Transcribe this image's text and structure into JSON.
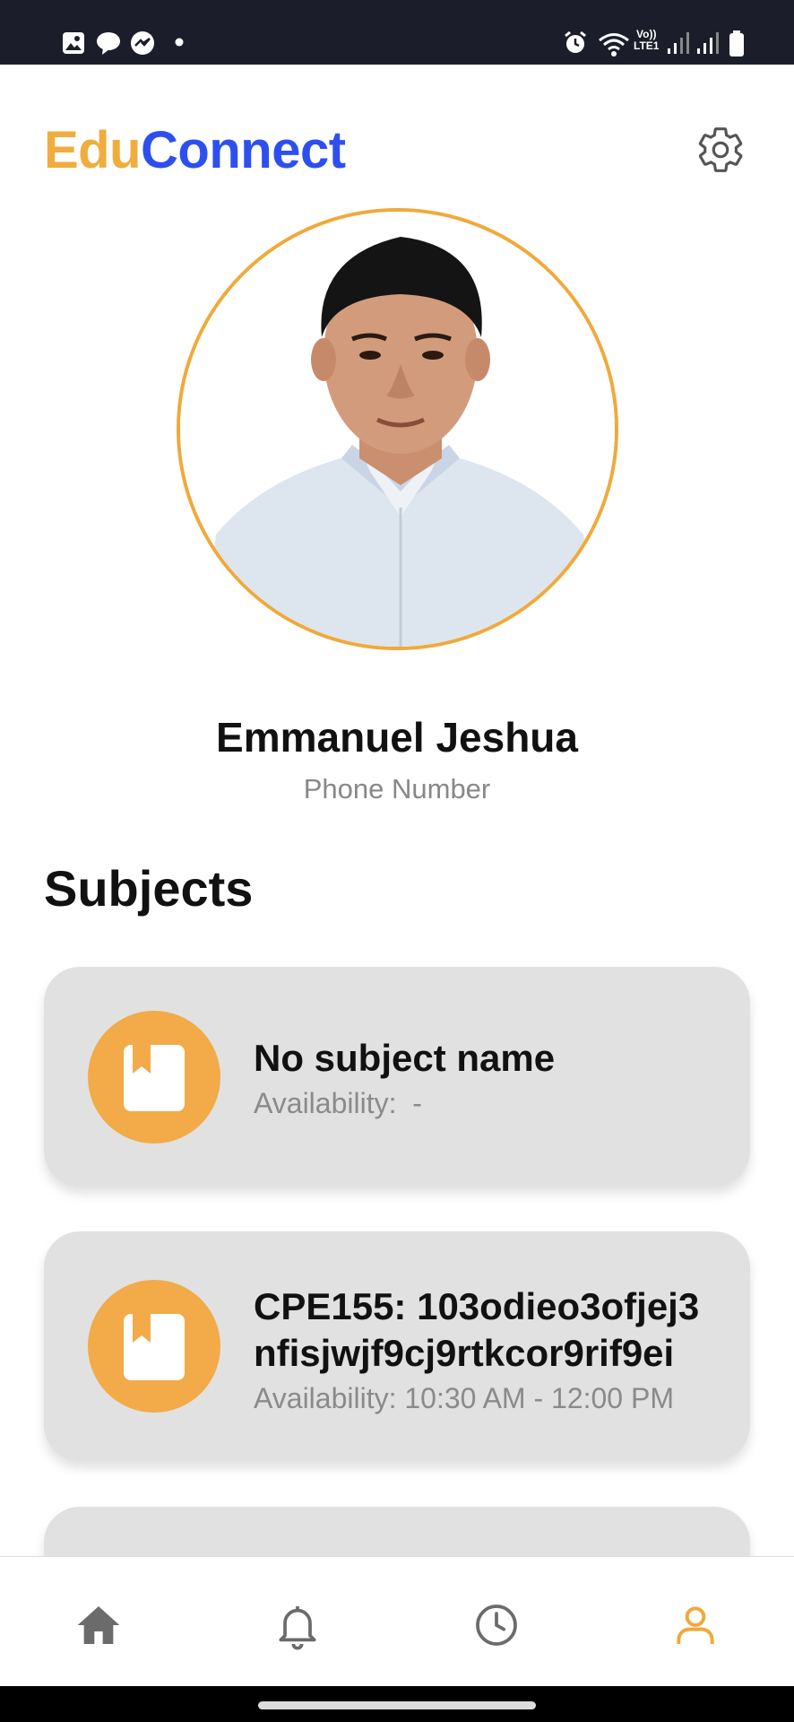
{
  "app": {
    "brand_part1": "Edu",
    "brand_part2": "Connect",
    "brand_color1": "#f0ad3e",
    "brand_color2": "#2e4ff0",
    "accent": "#f0a93b"
  },
  "status_bar": {
    "left_icons": [
      "gallery-icon",
      "chat-icon",
      "messenger-icon",
      "dot-icon"
    ],
    "right_icons": [
      "alarm-icon",
      "wifi-icon",
      "volte-icon",
      "signal-icon",
      "signal-icon",
      "battery-icon"
    ],
    "network_label_top": "Vo))",
    "network_label_bottom": "LTE1"
  },
  "profile": {
    "name": "Emmanuel Jeshua",
    "phone": "Phone Number"
  },
  "subjects": {
    "title": "Subjects",
    "items": [
      {
        "name": "No subject name",
        "availability": "Availability:  -"
      },
      {
        "name": "CPE155: 103odieo3ofjej3nfisjwjf9cj9rtkcor9rif9ei",
        "availability": "Availability: 10:30 AM - 12:00 PM"
      }
    ]
  },
  "bottom_nav": {
    "items": [
      {
        "icon": "home-icon",
        "active": false
      },
      {
        "icon": "bell-icon",
        "active": false
      },
      {
        "icon": "clock-icon",
        "active": false
      },
      {
        "icon": "profile-icon",
        "active": true
      }
    ]
  }
}
